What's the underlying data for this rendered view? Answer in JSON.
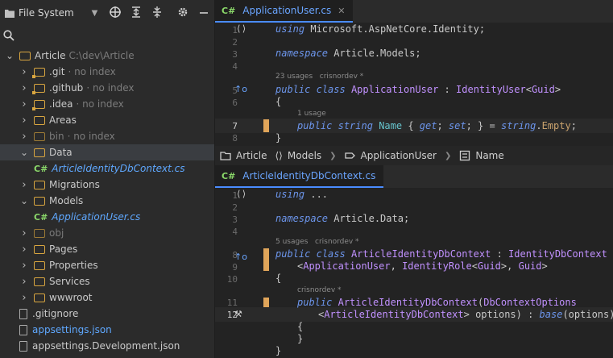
{
  "sidebar": {
    "header_title": "File System",
    "items": [
      {
        "label": "Article",
        "note": "C:\\dev\\Article",
        "level": 0,
        "expanded": true,
        "kind": "folder"
      },
      {
        "label": ".git",
        "note": "· no index",
        "level": 1,
        "kind": "folder",
        "muted": true
      },
      {
        "label": ".github",
        "note": "· no index",
        "level": 1,
        "kind": "folder",
        "muted": true
      },
      {
        "label": ".idea",
        "note": "· no index",
        "level": 1,
        "kind": "folder",
        "muted": true
      },
      {
        "label": "Areas",
        "note": "",
        "level": 1,
        "kind": "folder"
      },
      {
        "label": "bin",
        "note": "· no index",
        "level": 1,
        "kind": "folder",
        "dim": true
      },
      {
        "label": "Data",
        "note": "",
        "level": 1,
        "kind": "folder",
        "expanded": true,
        "selected": true
      },
      {
        "label": "ArticleIdentityDbContext.cs",
        "note": "",
        "level": 2,
        "kind": "cs"
      },
      {
        "label": "Migrations",
        "note": "",
        "level": 1,
        "kind": "folder"
      },
      {
        "label": "Models",
        "note": "",
        "level": 1,
        "kind": "folder",
        "expanded": true
      },
      {
        "label": "ApplicationUser.cs",
        "note": "",
        "level": 2,
        "kind": "cs"
      },
      {
        "label": "obj",
        "note": "",
        "level": 1,
        "kind": "folder",
        "dim": true
      },
      {
        "label": "Pages",
        "note": "",
        "level": 1,
        "kind": "folder"
      },
      {
        "label": "Properties",
        "note": "",
        "level": 1,
        "kind": "folder"
      },
      {
        "label": "Services",
        "note": "",
        "level": 1,
        "kind": "folder"
      },
      {
        "label": "wwwroot",
        "note": "",
        "level": 1,
        "kind": "folder"
      },
      {
        "label": ".gitignore",
        "note": "",
        "level": 1,
        "kind": "file"
      },
      {
        "label": "appsettings.json",
        "note": "",
        "level": 1,
        "kind": "json"
      },
      {
        "label": "appsettings.Development.json",
        "note": "",
        "level": 1,
        "kind": "json-plain"
      }
    ]
  },
  "editor_top": {
    "tab_icon": "C#",
    "tab_title": "ApplicationUser.cs",
    "tab_close": "✕",
    "line_numbers": [
      "1",
      "2",
      "3",
      "4",
      "5",
      "6",
      "7",
      "8"
    ],
    "line1": "using Microsoft.AspNetCore.Identity;",
    "line3": "namespace Article.Models;",
    "hint_usages": "23 usages",
    "hint_author": "crisnordev *",
    "line5": "public class ApplicationUser : IdentityUser<Guid>",
    "line6": "{",
    "hint_usage2": "1 usage",
    "line7": "public string Name { get; set; } = string.Empty;",
    "line8": "}"
  },
  "breadcrumb": [
    "Article",
    "Models",
    "ApplicationUser",
    "Name"
  ],
  "editor_bottom": {
    "tab_icon": "C#",
    "tab_title": "ArticleIdentityDbContext.cs",
    "line_numbers": [
      "1",
      "2",
      "3",
      "4",
      "",
      "",
      "8",
      "9",
      "10",
      "",
      "11",
      "12",
      "",
      "",
      "",
      ""
    ],
    "line1": "using ...",
    "line3": "namespace Article.Data;",
    "hint_usages": "5 usages",
    "hint_author": "crisnordev *",
    "line8a": "public class ArticleIdentityDbContext : IdentityDbContext",
    "line8b": "<ApplicationUser, IdentityRole<Guid>, Guid>",
    "line10": "{",
    "hint_author2": "crisnordev *",
    "line11": "public ArticleIdentityDbContext(DbContextOptions",
    "line12": "<ArticleIdentityDbContext> options) : base(options)",
    "line13": "{",
    "line14": "}",
    "line15": "}"
  }
}
